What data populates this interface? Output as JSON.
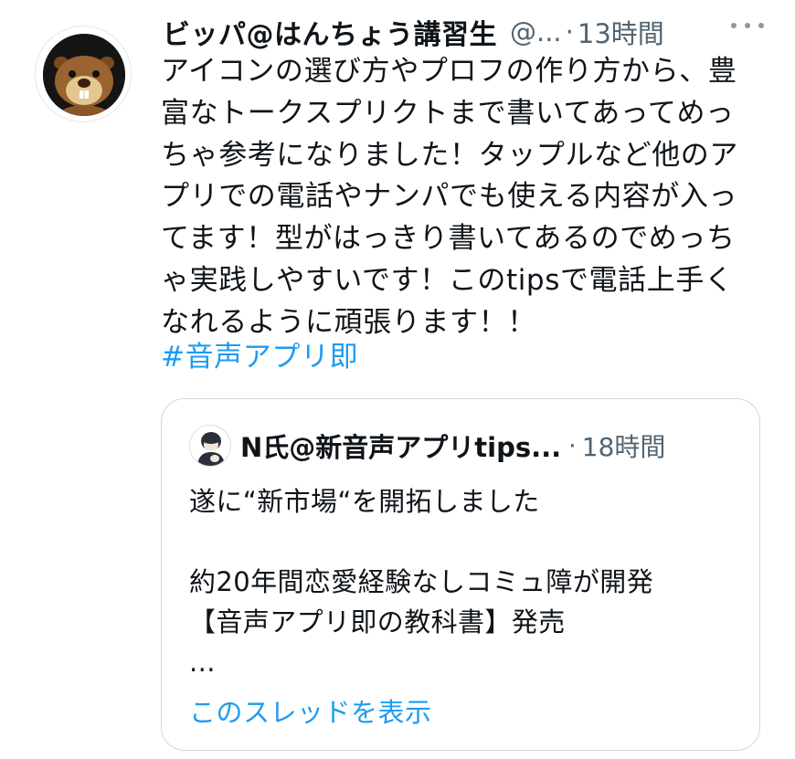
{
  "tweet": {
    "display_name": "ビッパ@はんちょう講習生",
    "handle": "@...",
    "separator": "·",
    "time": "13時間",
    "avatar_icon": "beaver-avatar-icon",
    "more_icon": "more-options-icon",
    "text_lines": [
      "アイコンの選び方やプロフの作り方から、豊",
      "富なトークスプリクトまで書いてあってめっ",
      "ちゃ参考になりました！タップルなど他のア",
      "プリでの電話やナンパでも使える内容が入っ",
      "てます！型がはっきり書いてあるのでめっち",
      "ゃ実践しやすいです！このtipsで電話上手く",
      "なれるように頑張ります！！"
    ],
    "hashtag": "#音声アプリ即"
  },
  "quoted_tweet": {
    "display_name": "N氏@新音声アプリtips...",
    "separator": "·",
    "time": "18時間",
    "avatar_icon": "person-avatar-icon",
    "text_lines": [
      "遂に“新市場“を開拓しました",
      "",
      "約20年間恋愛経験なしコミュ障が開発",
      "【音声アプリ即の教科書】発売",
      "..."
    ],
    "show_thread_label": "このスレッドを表示"
  },
  "colors": {
    "text": "#0f1419",
    "secondary": "#536471",
    "link": "#1d9bf0",
    "border": "#cfd9de"
  }
}
